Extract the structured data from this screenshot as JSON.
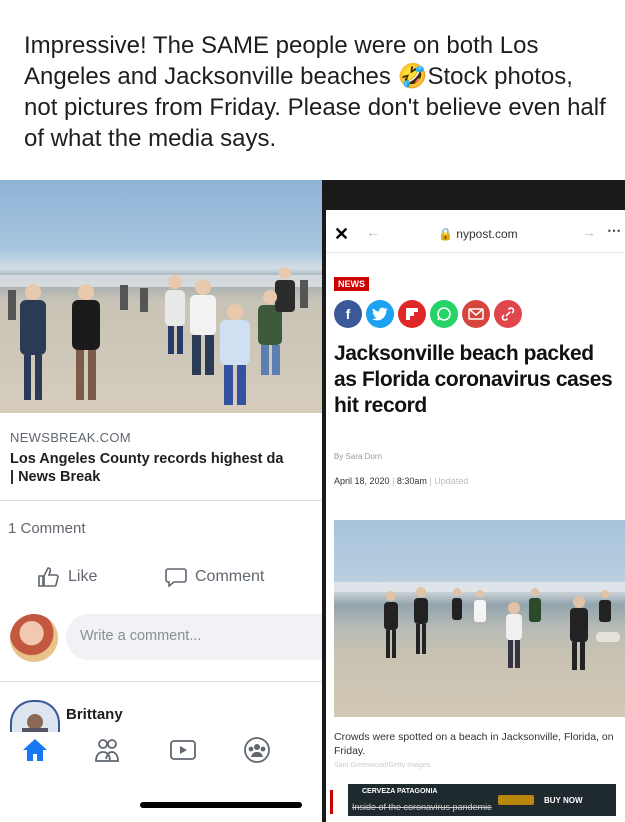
{
  "caption": {
    "text": "Impressive! The SAME people were on both Los Angeles and Jacksonville beaches 🤣Stock photos, not pictures from Friday. Please don't believe even half of what the media says."
  },
  "left_post": {
    "source": "NEWSBREAK.COM",
    "title_line1": "Los Angeles County records highest da",
    "title_line2": "| News Break",
    "comments_count": "1 Comment",
    "like_label": "Like",
    "comment_label": "Comment",
    "write_comment_placeholder": "Write a comment...",
    "next_user": "Brittany",
    "nav": [
      "home-icon",
      "friends-icon",
      "watch-icon",
      "groups-icon"
    ]
  },
  "right_article": {
    "url": "nypost.com",
    "badge": "NEWS",
    "share_icons": [
      "facebook-icon",
      "twitter-icon",
      "flipboard-icon",
      "whatsapp-icon",
      "email-icon",
      "link-icon"
    ],
    "headline": "Jacksonville beach packed as Florida coronavirus cases hit record",
    "byline": "By Sara Dorn",
    "date": "April 18, 2020",
    "time": "8:30am",
    "updated": "Updated",
    "photo_caption": "Crowds were spotted on a beach in Jacksonville, Florida, on Friday.",
    "photo_credit": "Sam Greenwood/Getty Images",
    "ad": {
      "brand": "CERVEZA PATAGONIA",
      "text": "Inside of the coronavirus pandemic",
      "button": "BUY NOW"
    }
  },
  "colors": {
    "facebook": "#3b5998",
    "twitter": "#1da1f2",
    "flipboard": "#e12828",
    "whatsapp": "#25d366",
    "email": "#d6453d",
    "link": "#e0474c",
    "news_red": "#cc0000"
  }
}
